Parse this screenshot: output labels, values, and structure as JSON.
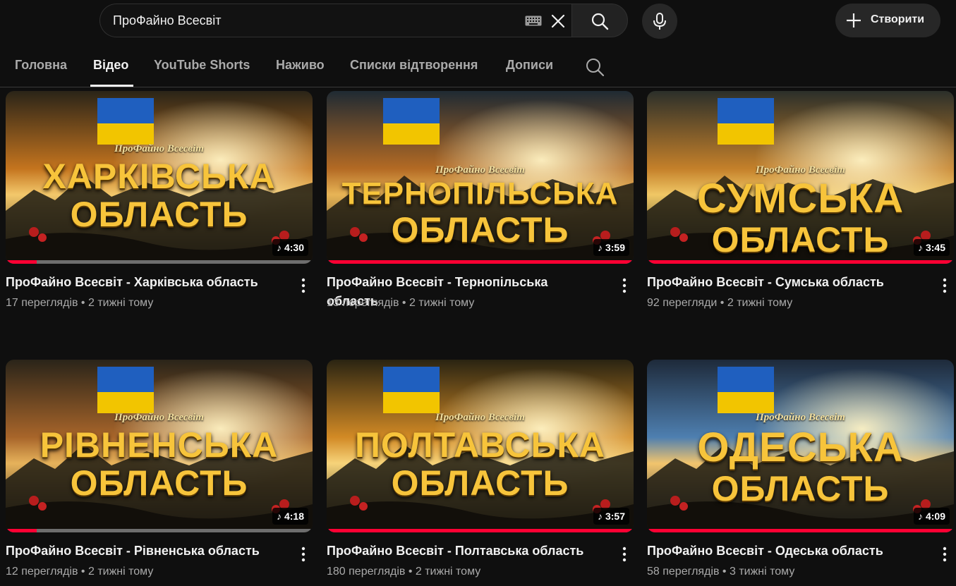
{
  "search": {
    "value": "ПроФайно Всесвіт"
  },
  "header": {
    "create_label": "Створити"
  },
  "tabs": [
    {
      "label": "Головна",
      "active": false
    },
    {
      "label": "Відео",
      "active": true
    },
    {
      "label": "YouTube Shorts",
      "active": false
    },
    {
      "label": "Наживо",
      "active": false
    },
    {
      "label": "Списки відтворення",
      "active": false
    },
    {
      "label": "Дописи",
      "active": false
    }
  ],
  "videos": [
    {
      "title": "ПроФайно Всесвіт - Харківська область",
      "views": "17 переглядів",
      "age": "2 тижні тому",
      "duration": "4:30",
      "progress": 0.1,
      "thumb_brand": "ПроФайно Всесвіт",
      "thumb_line1": "ХАРКІВСЬКА",
      "thumb_line2": "ОБЛАСТЬ"
    },
    {
      "title": "ПроФайно Всесвіт - Тернопільська область",
      "views": "13 переглядів",
      "age": "2 тижні тому",
      "duration": "3:59",
      "progress": 1.0,
      "thumb_brand": "ПроФайно Всесвіт",
      "thumb_line1": "ТЕРНОПІЛЬСЬКА",
      "thumb_line2": "ОБЛАСТЬ"
    },
    {
      "title": "ПроФайно Всесвіт - Сумська область",
      "views": "92 перегляди",
      "age": "2 тижні тому",
      "duration": "3:45",
      "progress": 1.0,
      "thumb_brand": "ПроФайно Всесвіт",
      "thumb_line1": "СУМСЬКА",
      "thumb_line2": "ОБЛАСТЬ"
    },
    {
      "title": "ПроФайно Всесвіт - Рівненська область",
      "views": "12 переглядів",
      "age": "2 тижні тому",
      "duration": "4:18",
      "progress": 0.1,
      "thumb_brand": "ПроФайно Всесвіт",
      "thumb_line1": "РІВНЕНСЬКА",
      "thumb_line2": "ОБЛАСТЬ"
    },
    {
      "title": "ПроФайно Всесвіт - Полтавська область",
      "views": "180 переглядів",
      "age": "2 тижні тому",
      "duration": "3:57",
      "progress": 1.0,
      "thumb_brand": "ПроФайно Всесвіт",
      "thumb_line1": "ПОЛТАВСЬКА",
      "thumb_line2": "ОБЛАСТЬ"
    },
    {
      "title": "ПроФайно Всесвіт - Одеська область",
      "views": "58 переглядів",
      "age": "3 тижні тому",
      "duration": "4:09",
      "progress": 1.0,
      "thumb_brand": "ПроФайно Всесвіт",
      "thumb_line1": "ОДЕСЬКА",
      "thumb_line2": "ОБЛАСТЬ"
    }
  ],
  "colors": {
    "background": "#0f0f0f",
    "progress": "#ff0033",
    "thumb_gold": "#f7c43b"
  }
}
